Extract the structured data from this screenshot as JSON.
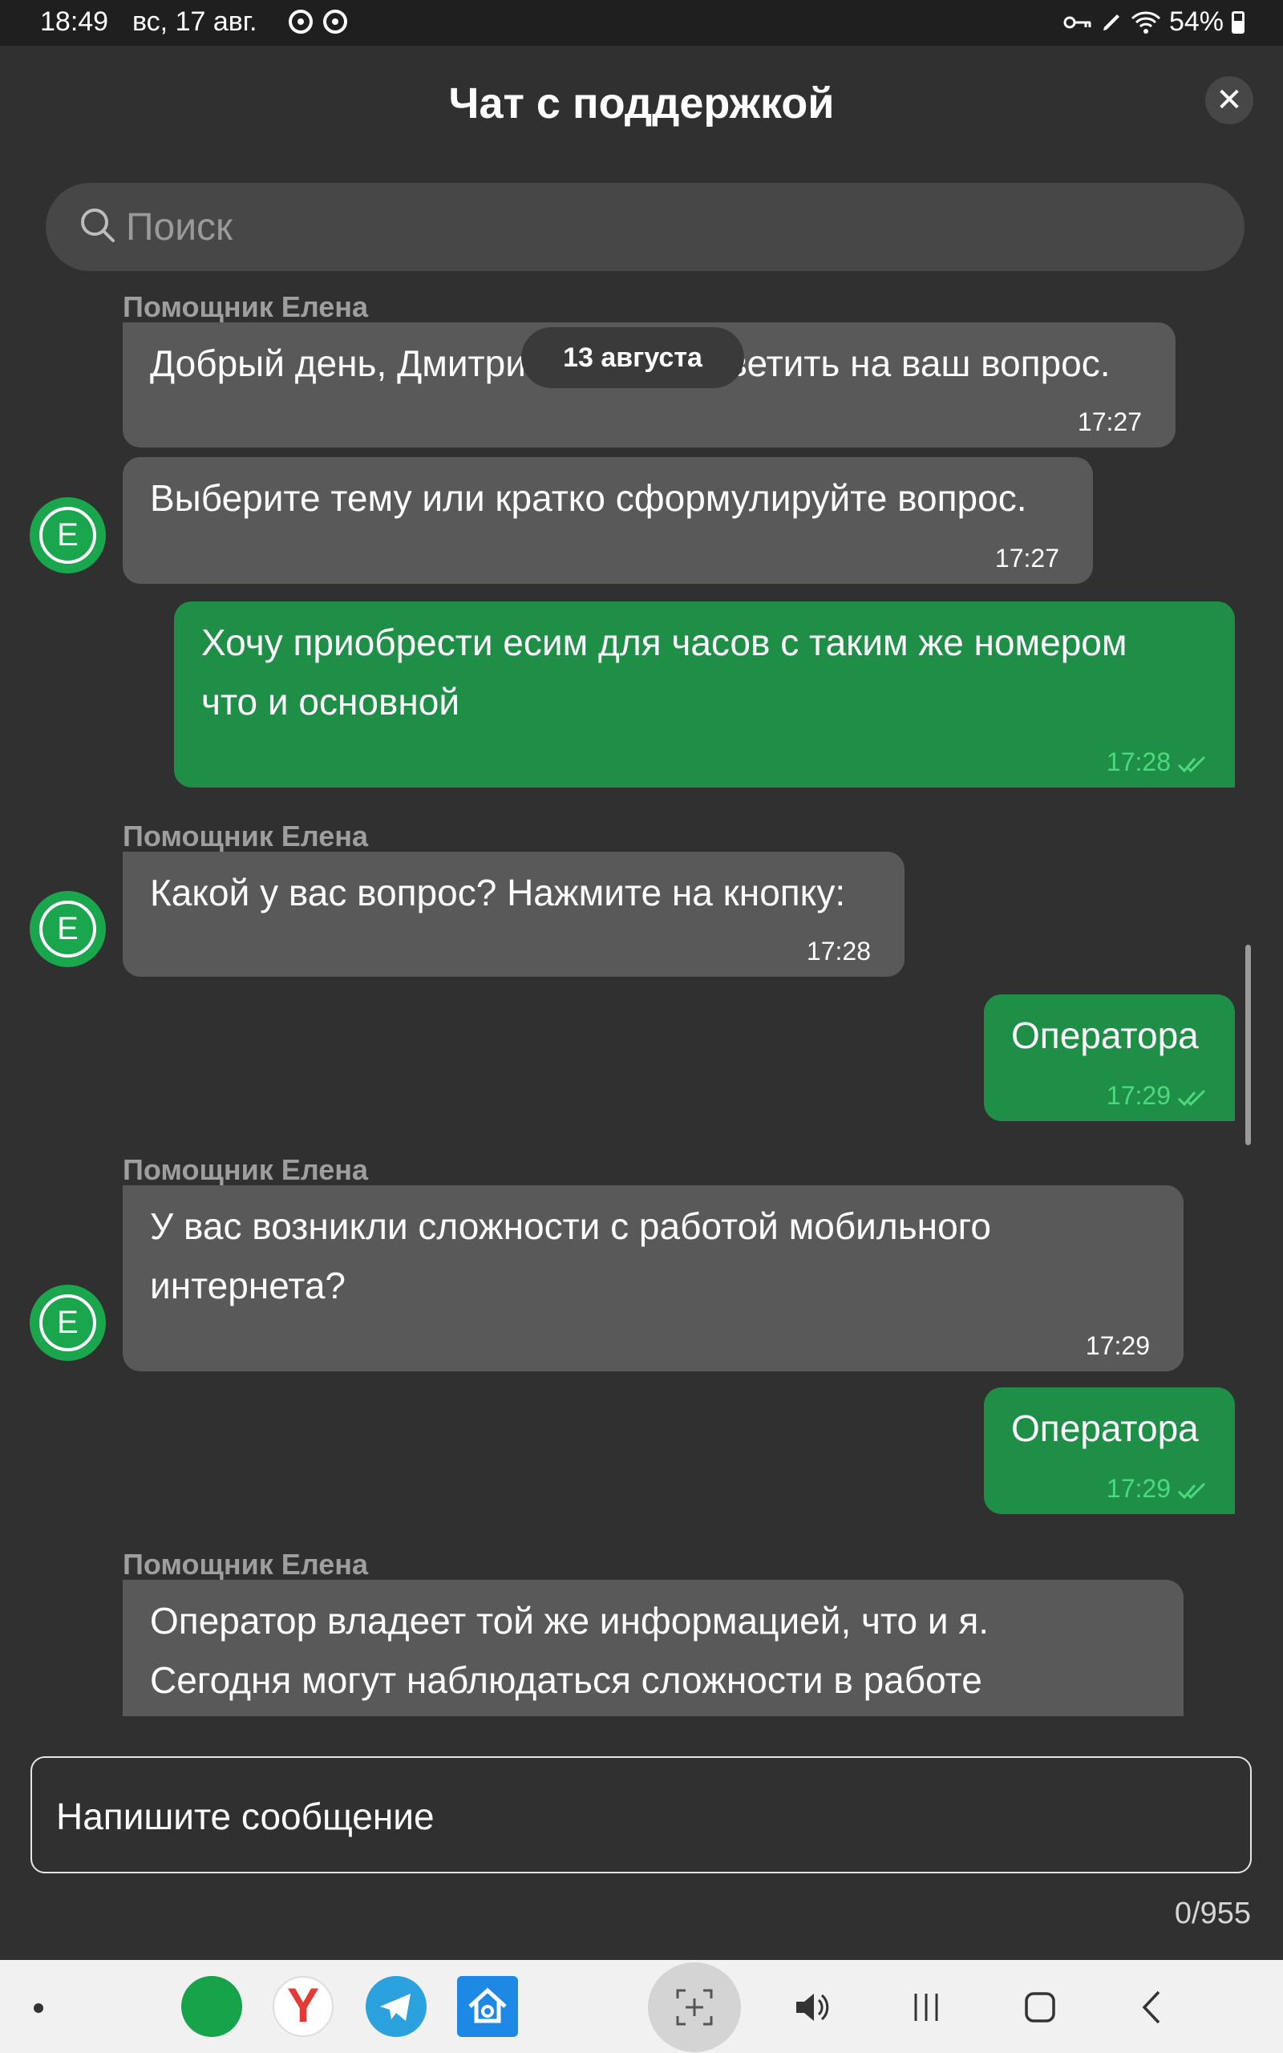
{
  "status_bar": {
    "time": "18:49",
    "date": "вс, 17 авг.",
    "battery": "54%"
  },
  "header": {
    "title": "Чат с поддержкой",
    "close_label": "✕"
  },
  "search": {
    "placeholder": "Поиск"
  },
  "date_separator": "13 августа",
  "messages": [
    {
      "type": "in",
      "sender": "Помощник Елена",
      "text": "Добрый день, Дмитрий! Готова ответить на ваш вопрос.",
      "time": "17:27"
    },
    {
      "type": "in",
      "text": "Выберите тему или кратко сформулируйте вопрос.",
      "time": "17:27"
    },
    {
      "type": "out",
      "line1": "Хочу приобрести есим для часов с таким же номером",
      "line2": "что и основной",
      "time": "17:28"
    },
    {
      "type": "in",
      "sender": "Помощник Елена",
      "text": "Какой у вас вопрос? Нажмите на кнопку:",
      "time": "17:28"
    },
    {
      "type": "out",
      "text": "Оператора",
      "time": "17:29"
    },
    {
      "type": "in",
      "sender": "Помощник Елена",
      "line1": "У вас возникли сложности с работой мобильного",
      "line2": "интернета?",
      "time": "17:29"
    },
    {
      "type": "out",
      "text": "Оператора",
      "time": "17:29"
    },
    {
      "type": "in",
      "sender": "Помощник Елена",
      "line1": "Оператор владеет той же информацией, что и я.",
      "line2": "Сегодня могут наблюдаться сложности в работе"
    }
  ],
  "avatar_letter": "E",
  "composer": {
    "placeholder": "Напишите сообщение",
    "counter": "0/955"
  },
  "colors": {
    "background": "#303030",
    "incoming_bubble": "#595959",
    "outgoing_bubble": "#1f8f48",
    "accent_green": "#4cd97f"
  },
  "icons": [
    "search-icon",
    "close-icon",
    "double-check-icon",
    "megafon-app-icon",
    "yandex-app-icon",
    "telegram-app-icon",
    "smart-home-app-icon",
    "screenshot-icon",
    "volume-icon",
    "recent-apps-icon",
    "home-icon",
    "back-icon"
  ]
}
